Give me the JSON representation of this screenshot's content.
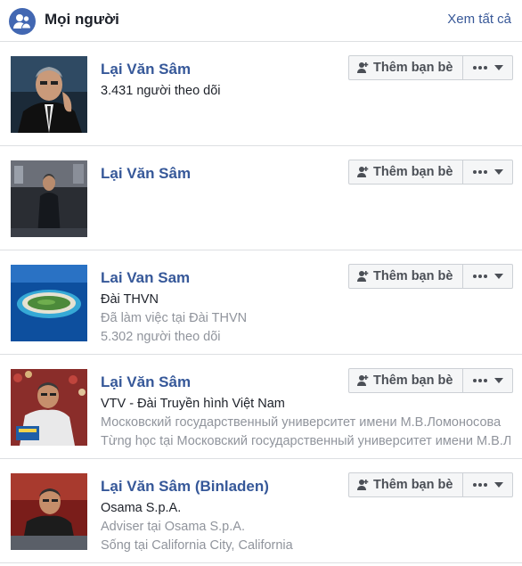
{
  "header": {
    "title": "Mọi người",
    "see_all": "Xem tất cả",
    "icon": "people-icon"
  },
  "buttons": {
    "add_friend": "Thêm bạn bè",
    "more_icon": "more-icon",
    "caret_icon": "caret-down-icon"
  },
  "results": [
    {
      "name": "Lại Văn Sâm",
      "lines": [
        {
          "text": "3.431 người theo dõi",
          "style": "dark"
        }
      ]
    },
    {
      "name": "Lại Văn Sâm",
      "lines": []
    },
    {
      "name": "Lai Van Sam",
      "lines": [
        {
          "text": "Đài THVN",
          "style": "dark"
        },
        {
          "text": "Đã làm việc tại Đài THVN",
          "style": "grey"
        },
        {
          "text": "5.302 người theo dõi",
          "style": "grey"
        }
      ]
    },
    {
      "name": "Lại Văn Sâm",
      "lines": [
        {
          "text": "VTV - Đài Truyền hình Việt Nam",
          "style": "dark"
        },
        {
          "text": "Московский государственный университет имени М.В.Ломоносова",
          "style": "grey"
        },
        {
          "text": "Từng học tại Московский государственный университет имени М.В.Ломоносова",
          "style": "grey"
        }
      ]
    },
    {
      "name": "Lại Văn Sâm (Binladen)",
      "lines": [
        {
          "text": "Osama S.p.A.",
          "style": "dark"
        },
        {
          "text": "Adviser tại Osama S.p.A.",
          "style": "grey"
        },
        {
          "text": "Sống tại California City, California",
          "style": "grey"
        }
      ]
    }
  ]
}
